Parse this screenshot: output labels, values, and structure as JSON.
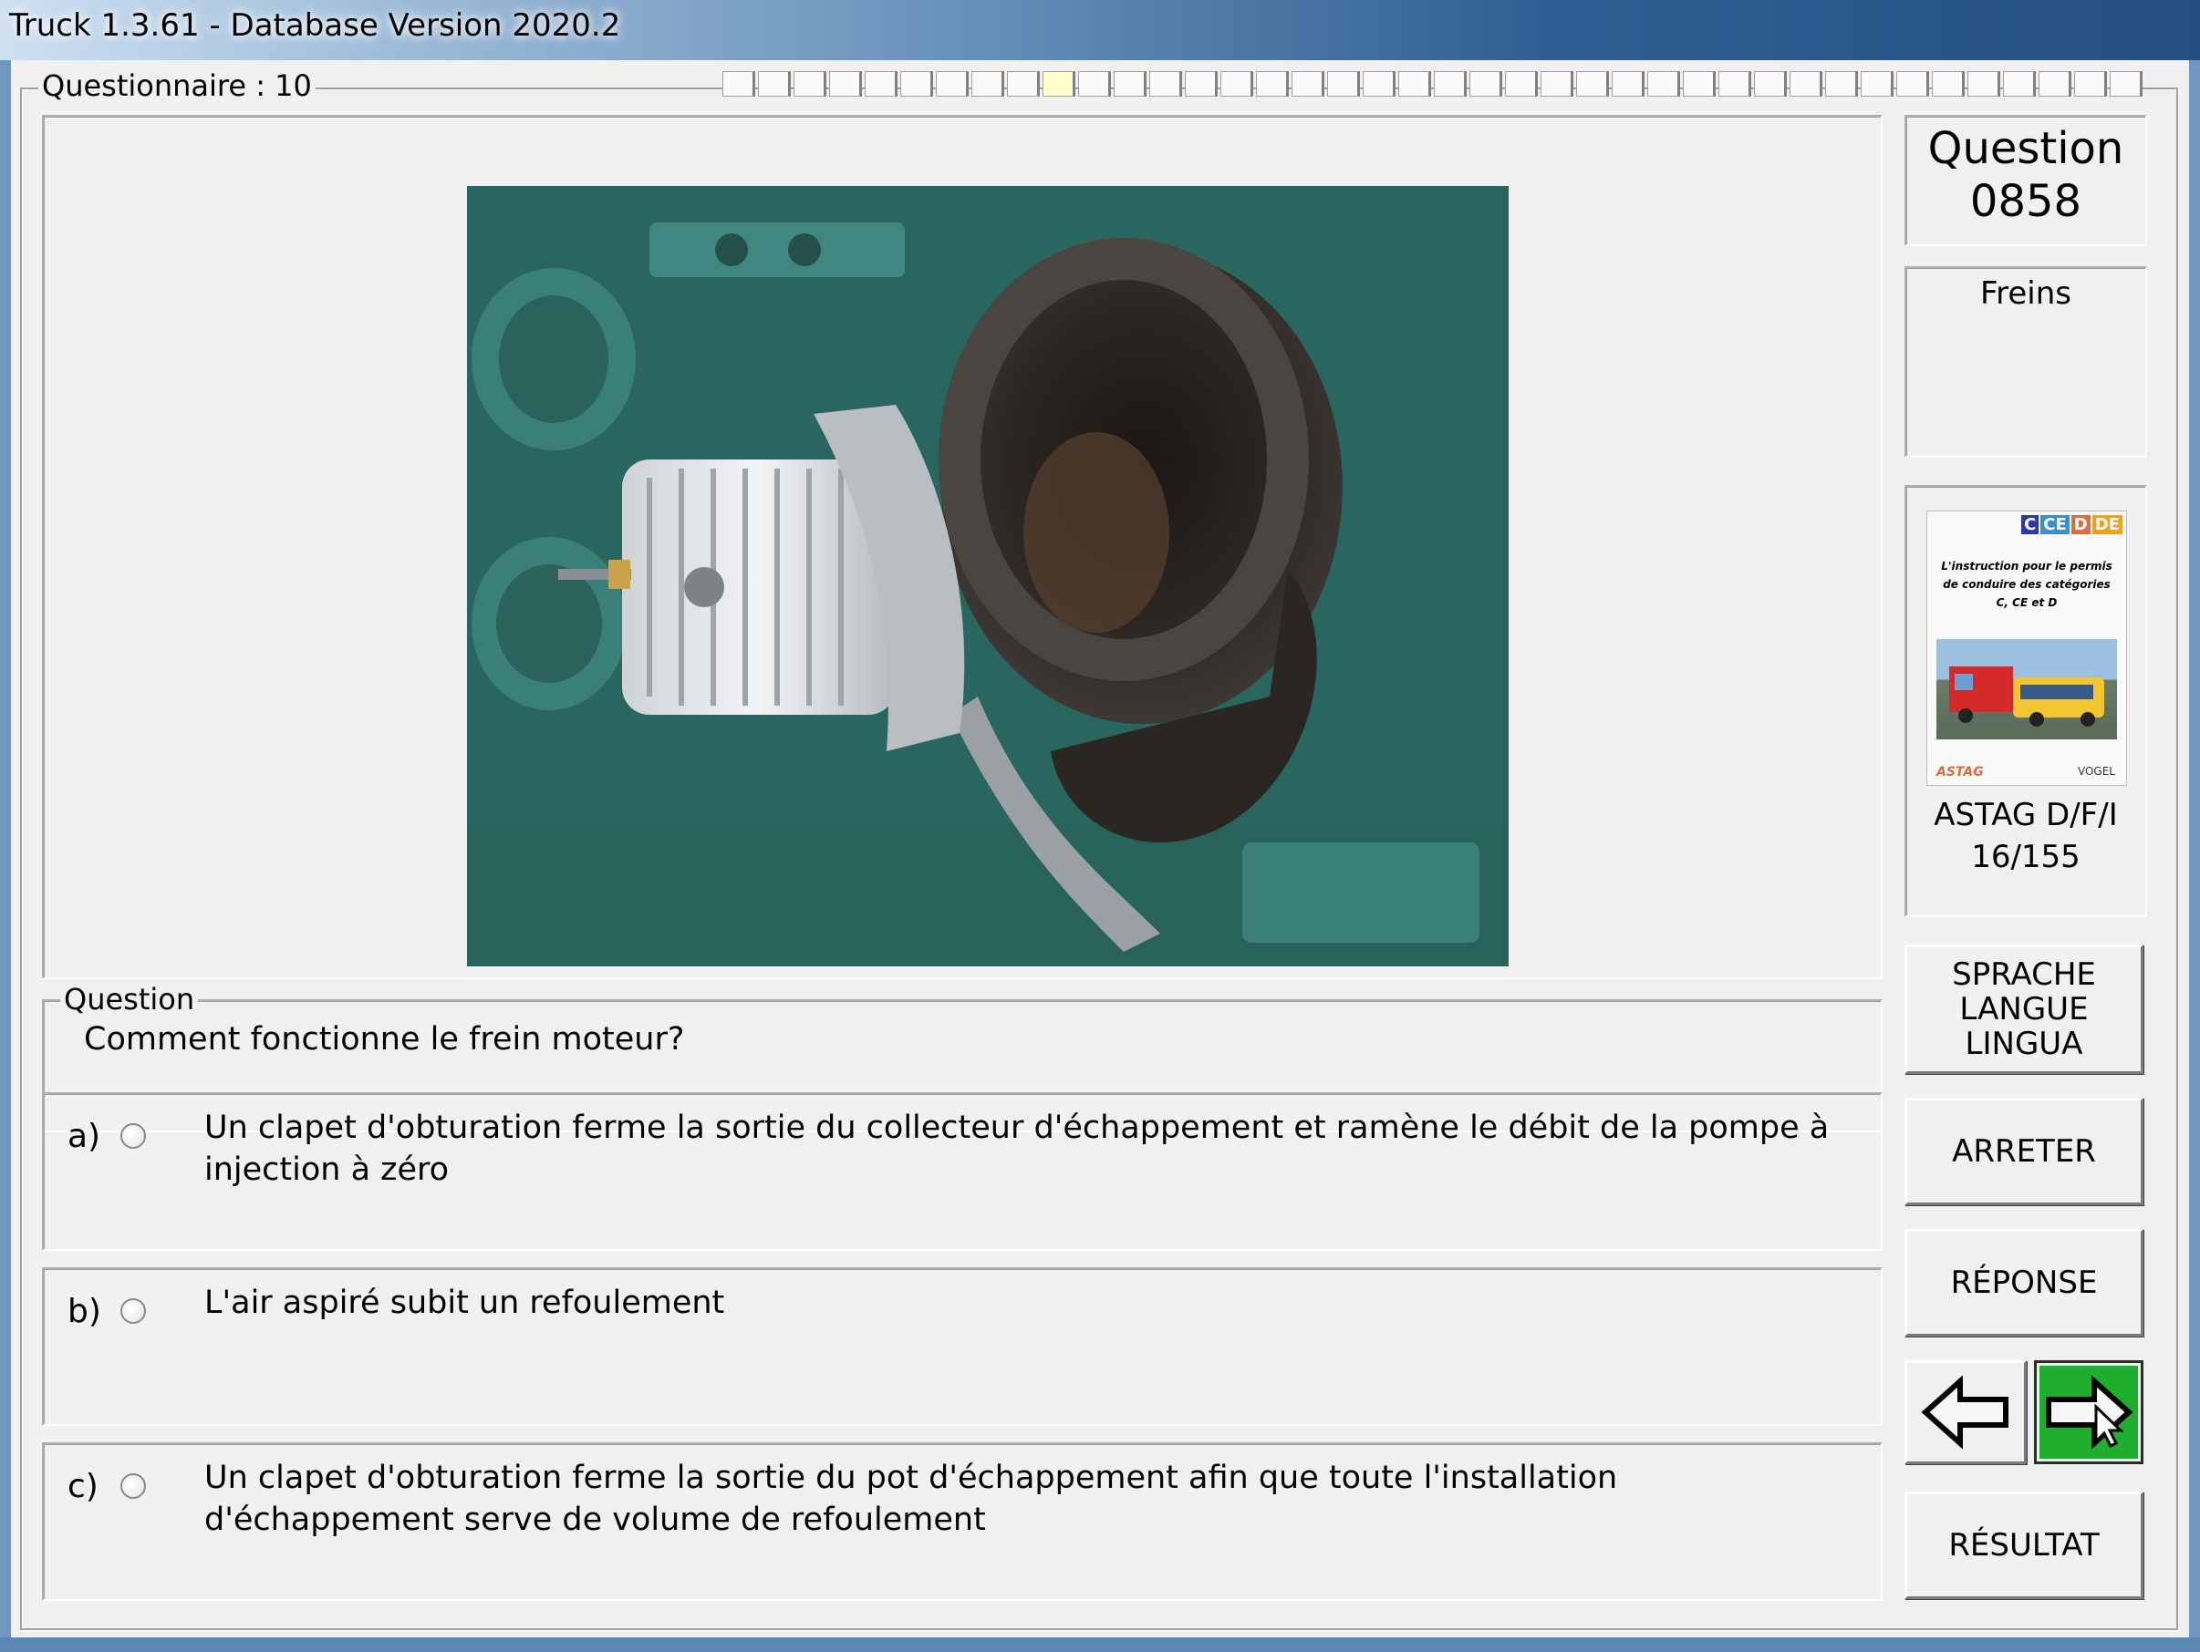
{
  "window": {
    "title": "Truck 1.3.61 - Database Version 2020.2"
  },
  "questionnaire": {
    "label": "Questionnaire : 10",
    "progress_total_cells": 40,
    "progress_current_index": 10
  },
  "question": {
    "group_label": "Question",
    "text": "Comment fonctionne le frein moteur?"
  },
  "answers": [
    {
      "letter": "a)",
      "text": "Un clapet d'obturation ferme la sortie du collecteur d'échappement et ramène le débit de la pompe à injection à zéro"
    },
    {
      "letter": "b)",
      "text": "L'air aspiré subit un refoulement"
    },
    {
      "letter": "c)",
      "text": "Un clapet d'obturation ferme la sortie du pot d'échappement afin que toute l'installation d'échappement serve de volume de refoulement"
    }
  ],
  "sidebar": {
    "question_label": "Question",
    "question_number": "0858",
    "category": "Freins",
    "book": {
      "badge_c": "C",
      "badge_ce": "CE",
      "badge_d": "D",
      "badge_de": "DE",
      "cover_text": "L'instruction pour le permis de conduire des catégories C, CE et D",
      "publisher_left": "ASTAG",
      "publisher_right": "VOGEL",
      "source": "ASTAG D/F/I",
      "page": "16/155"
    },
    "buttons": {
      "language_1": "SPRACHE",
      "language_2": "LANGUE",
      "language_3": "LINGUA",
      "stop": "ARRETER",
      "answer": "RÉPONSE",
      "result": "RÉSULTAT"
    }
  },
  "colors": {
    "next_button": "#1fae2e",
    "engine_green": "#2e6d66",
    "title_bar": "#6f97bf"
  }
}
